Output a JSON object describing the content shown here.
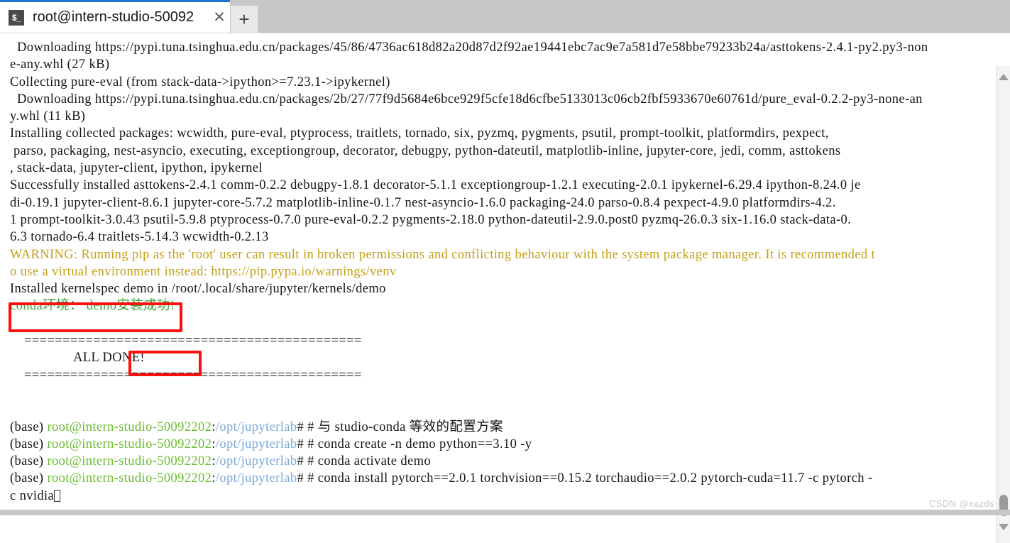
{
  "window": {
    "tab": {
      "icon": "terminal-prompt-icon",
      "icon_glyph": "$_",
      "title": "root@intern-studio-50092",
      "close_glyph": "✕"
    },
    "new_tab_glyph": "+",
    "accent_color": "#1f72d0"
  },
  "watermark": "CSDN @xazds",
  "scrollbar": {
    "up_arrow": "scroll-up-arrow",
    "down_arrow": "scroll-down-arrow",
    "thumb": "scroll-thumb"
  },
  "annotations": {
    "conda_box_color": "#fa0f0f",
    "alldone_box_color": "#fa0f0f"
  },
  "terminal": {
    "colors": {
      "default_text": "#151515",
      "warning": "#c6a017",
      "prompt_user": "#6abe30",
      "prompt_path": "#7aa8dd",
      "success_message": "#3aa33a"
    },
    "lines": {
      "l01": "  Downloading https://pypi.tuna.tsinghua.edu.cn/packages/45/86/4736ac618d82a20d87d2f92ae19441ebc7ac9e7a581d7e58bbe79233b24a/asttokens-2.4.1-py2.py3-non",
      "l02": "e-any.whl (27 kB)",
      "l03": "Collecting pure-eval (from stack-data->ipython>=7.23.1->ipykernel)",
      "l04": "  Downloading https://pypi.tuna.tsinghua.edu.cn/packages/2b/27/77f9d5684e6bce929f5cfe18d6cfbe5133013c06cb2fbf5933670e60761d/pure_eval-0.2.2-py3-none-an",
      "l05": "y.whl (11 kB)",
      "l06": "Installing collected packages: wcwidth, pure-eval, ptyprocess, traitlets, tornado, six, pyzmq, pygments, psutil, prompt-toolkit, platformdirs, pexpect,",
      "l07": " parso, packaging, nest-asyncio, executing, exceptiongroup, decorator, debugpy, python-dateutil, matplotlib-inline, jupyter-core, jedi, comm, asttokens",
      "l08": ", stack-data, jupyter-client, ipython, ipykernel",
      "l09": "Successfully installed asttokens-2.4.1 comm-0.2.2 debugpy-1.8.1 decorator-5.1.1 exceptiongroup-1.2.1 executing-2.0.1 ipykernel-6.29.4 ipython-8.24.0 je",
      "l10": "di-0.19.1 jupyter-client-8.6.1 jupyter-core-5.7.2 matplotlib-inline-0.1.7 nest-asyncio-1.6.0 packaging-24.0 parso-0.8.4 pexpect-4.9.0 platformdirs-4.2.",
      "l11": "1 prompt-toolkit-3.0.43 psutil-5.9.8 ptyprocess-0.7.0 pure-eval-0.2.2 pygments-2.18.0 python-dateutil-2.9.0.post0 pyzmq-26.0.3 six-1.16.0 stack-data-0.",
      "l12": "6.3 tornado-6.4 traitlets-5.14.3 wcwidth-0.2.13",
      "l13": "WARNING: Running pip as the 'root' user can result in broken permissions and conflicting behaviour with the system package manager. It is recommended t",
      "l14": "o use a virtual environment instead: https://pip.pypa.io/warnings/venv",
      "l15": "Installed kernelspec demo in /root/.local/share/jupyter/kernels/demo",
      "l16": "conda环境： demo安装成功!",
      "l18": "    ============================================",
      "l19": "                  ALL DONE!",
      "l20": "    ============================================",
      "prompt_base": "(base) ",
      "prompt_user": "root@intern-studio-50092202",
      "prompt_colon": ":",
      "prompt_path": "/opt/jupyterlab",
      "prompt_hash": "# ",
      "cmd1": "# 与 studio-conda 等效的配置方案",
      "cmd2": "# conda create -n demo python==3.10 -y",
      "cmd3": "# conda activate demo",
      "cmd4": "# conda install pytorch==2.0.1 torchvision==0.15.2 torchaudio==2.0.2 pytorch-cuda=11.7 -c pytorch -",
      "cmd4_wrap": "c nvidia"
    }
  }
}
